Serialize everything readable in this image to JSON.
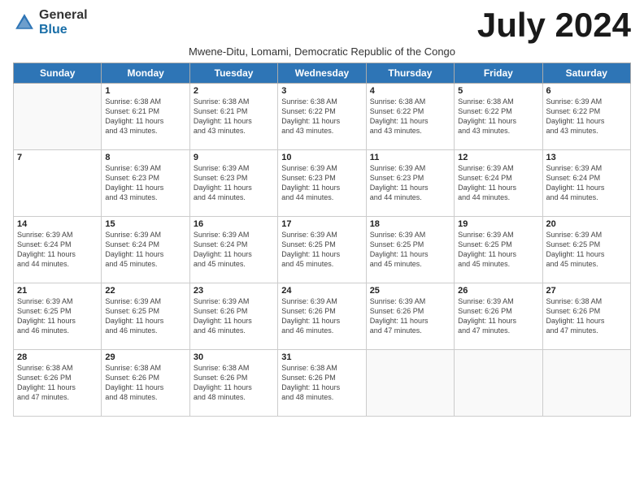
{
  "logo": {
    "general": "General",
    "blue": "Blue"
  },
  "title": "July 2024",
  "subtitle": "Mwene-Ditu, Lomami, Democratic Republic of the Congo",
  "weekdays": [
    "Sunday",
    "Monday",
    "Tuesday",
    "Wednesday",
    "Thursday",
    "Friday",
    "Saturday"
  ],
  "weeks": [
    [
      {
        "day": "",
        "info": ""
      },
      {
        "day": "1",
        "info": "Sunrise: 6:38 AM\nSunset: 6:21 PM\nDaylight: 11 hours\nand 43 minutes."
      },
      {
        "day": "2",
        "info": "Sunrise: 6:38 AM\nSunset: 6:21 PM\nDaylight: 11 hours\nand 43 minutes."
      },
      {
        "day": "3",
        "info": "Sunrise: 6:38 AM\nSunset: 6:22 PM\nDaylight: 11 hours\nand 43 minutes."
      },
      {
        "day": "4",
        "info": "Sunrise: 6:38 AM\nSunset: 6:22 PM\nDaylight: 11 hours\nand 43 minutes."
      },
      {
        "day": "5",
        "info": "Sunrise: 6:38 AM\nSunset: 6:22 PM\nDaylight: 11 hours\nand 43 minutes."
      },
      {
        "day": "6",
        "info": "Sunrise: 6:39 AM\nSunset: 6:22 PM\nDaylight: 11 hours\nand 43 minutes."
      }
    ],
    [
      {
        "day": "7",
        "info": ""
      },
      {
        "day": "8",
        "info": "Sunrise: 6:39 AM\nSunset: 6:23 PM\nDaylight: 11 hours\nand 43 minutes."
      },
      {
        "day": "9",
        "info": "Sunrise: 6:39 AM\nSunset: 6:23 PM\nDaylight: 11 hours\nand 44 minutes."
      },
      {
        "day": "10",
        "info": "Sunrise: 6:39 AM\nSunset: 6:23 PM\nDaylight: 11 hours\nand 44 minutes."
      },
      {
        "day": "11",
        "info": "Sunrise: 6:39 AM\nSunset: 6:23 PM\nDaylight: 11 hours\nand 44 minutes."
      },
      {
        "day": "12",
        "info": "Sunrise: 6:39 AM\nSunset: 6:24 PM\nDaylight: 11 hours\nand 44 minutes."
      },
      {
        "day": "13",
        "info": "Sunrise: 6:39 AM\nSunset: 6:24 PM\nDaylight: 11 hours\nand 44 minutes."
      }
    ],
    [
      {
        "day": "14",
        "info": "Sunrise: 6:39 AM\nSunset: 6:24 PM\nDaylight: 11 hours\nand 44 minutes."
      },
      {
        "day": "15",
        "info": "Sunrise: 6:39 AM\nSunset: 6:24 PM\nDaylight: 11 hours\nand 45 minutes."
      },
      {
        "day": "16",
        "info": "Sunrise: 6:39 AM\nSunset: 6:24 PM\nDaylight: 11 hours\nand 45 minutes."
      },
      {
        "day": "17",
        "info": "Sunrise: 6:39 AM\nSunset: 6:25 PM\nDaylight: 11 hours\nand 45 minutes."
      },
      {
        "day": "18",
        "info": "Sunrise: 6:39 AM\nSunset: 6:25 PM\nDaylight: 11 hours\nand 45 minutes."
      },
      {
        "day": "19",
        "info": "Sunrise: 6:39 AM\nSunset: 6:25 PM\nDaylight: 11 hours\nand 45 minutes."
      },
      {
        "day": "20",
        "info": "Sunrise: 6:39 AM\nSunset: 6:25 PM\nDaylight: 11 hours\nand 45 minutes."
      }
    ],
    [
      {
        "day": "21",
        "info": "Sunrise: 6:39 AM\nSunset: 6:25 PM\nDaylight: 11 hours\nand 46 minutes."
      },
      {
        "day": "22",
        "info": "Sunrise: 6:39 AM\nSunset: 6:25 PM\nDaylight: 11 hours\nand 46 minutes."
      },
      {
        "day": "23",
        "info": "Sunrise: 6:39 AM\nSunset: 6:26 PM\nDaylight: 11 hours\nand 46 minutes."
      },
      {
        "day": "24",
        "info": "Sunrise: 6:39 AM\nSunset: 6:26 PM\nDaylight: 11 hours\nand 46 minutes."
      },
      {
        "day": "25",
        "info": "Sunrise: 6:39 AM\nSunset: 6:26 PM\nDaylight: 11 hours\nand 47 minutes."
      },
      {
        "day": "26",
        "info": "Sunrise: 6:39 AM\nSunset: 6:26 PM\nDaylight: 11 hours\nand 47 minutes."
      },
      {
        "day": "27",
        "info": "Sunrise: 6:38 AM\nSunset: 6:26 PM\nDaylight: 11 hours\nand 47 minutes."
      }
    ],
    [
      {
        "day": "28",
        "info": "Sunrise: 6:38 AM\nSunset: 6:26 PM\nDaylight: 11 hours\nand 47 minutes."
      },
      {
        "day": "29",
        "info": "Sunrise: 6:38 AM\nSunset: 6:26 PM\nDaylight: 11 hours\nand 48 minutes."
      },
      {
        "day": "30",
        "info": "Sunrise: 6:38 AM\nSunset: 6:26 PM\nDaylight: 11 hours\nand 48 minutes."
      },
      {
        "day": "31",
        "info": "Sunrise: 6:38 AM\nSunset: 6:26 PM\nDaylight: 11 hours\nand 48 minutes."
      },
      {
        "day": "",
        "info": ""
      },
      {
        "day": "",
        "info": ""
      },
      {
        "day": "",
        "info": ""
      }
    ]
  ]
}
